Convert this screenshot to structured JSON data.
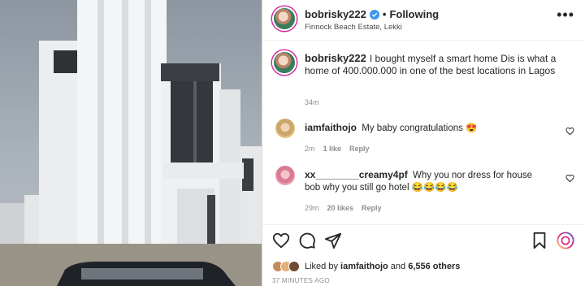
{
  "post": {
    "header": {
      "username": "bobrisky222",
      "follow_status": "Following",
      "separator": "•",
      "location": "Finnock Beach Estate, Lekki",
      "more_label": "•••"
    },
    "caption": {
      "username": "bobrisky222",
      "text": "I bought myself a smart home Dis is what a home of 400.000.000 in one of the best locations in Lagos",
      "time": "34m"
    },
    "comments": [
      {
        "username": "iamfaithojo",
        "text": "My baby congratulations 😍",
        "time": "2m",
        "likes": "1 like",
        "reply_label": "Reply"
      },
      {
        "username": "xx________creamy4pf",
        "text": "Why you nor dress for house bob why you still go hotel 😂😂😂😂",
        "time": "29m",
        "likes": "20 likes",
        "reply_label": "Reply"
      }
    ],
    "likes": {
      "prefix": "Liked by",
      "user": "iamfaithojo",
      "and": "and",
      "others": "6,556 others"
    },
    "posted_time": "37 MINUTES AGO",
    "colors": {
      "verified": "#3897f0",
      "text": "#262626",
      "muted": "#8e8e8e",
      "ring": "#d6249f"
    },
    "icons": [
      "heart-icon",
      "comment-icon",
      "share-icon",
      "bookmark-icon",
      "emoji-icon",
      "verified-icon",
      "more-icon"
    ]
  }
}
